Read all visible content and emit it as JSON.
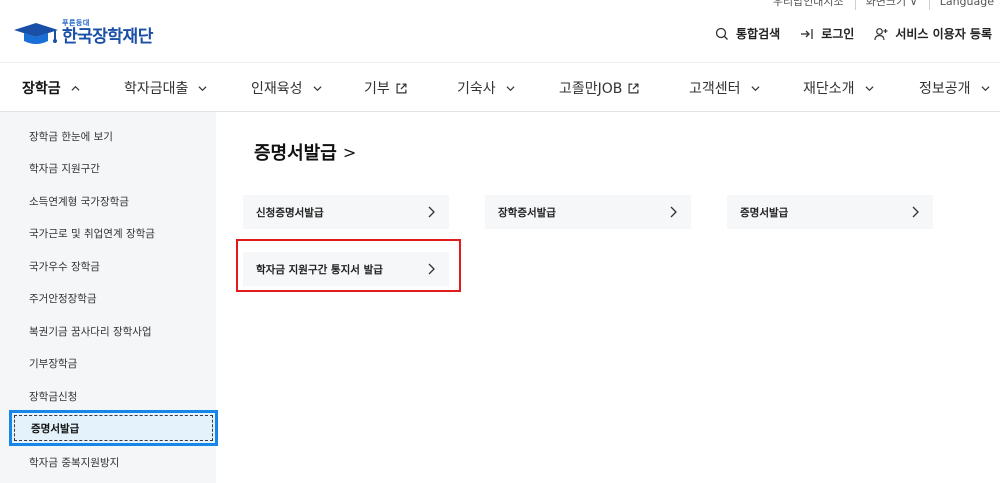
{
  "util_bar": {
    "items": [
      "우리밥인대지조",
      "화면크기 ∨",
      "Language"
    ]
  },
  "header": {
    "logo_small": "푸른등대",
    "logo_main": "한국장학재단",
    "actions": {
      "search": "통합검색",
      "login": "로그인",
      "register": "서비스 이용자 등록"
    }
  },
  "gnb": {
    "items": [
      {
        "label": "장학금",
        "chevron": "up"
      },
      {
        "label": "학자금대출",
        "chevron": "down"
      },
      {
        "label": "인재육성",
        "chevron": "down"
      },
      {
        "label": "기부",
        "icon": "external-link-icon"
      },
      {
        "label": "기숙사",
        "chevron": "down"
      },
      {
        "label": "고졸만JOB",
        "icon": "external-link-icon"
      },
      {
        "label": "고객센터",
        "chevron": "down"
      },
      {
        "label": "재단소개",
        "chevron": "down"
      },
      {
        "label": "정보공개",
        "chevron": "down"
      }
    ]
  },
  "sidebar": {
    "items": [
      "장학금 한눈에 보기",
      "학자금 지원구간",
      "소득연계형 국가장학금",
      "국가근로 및 취업연계 장학금",
      "국가우수 장학금",
      "주거안정장학금",
      "복권기금 꿈사다리 장학사업",
      "기부장학금",
      "장학금신청",
      "증명서발급",
      "학자금 중복지원방지"
    ],
    "active_index": 9
  },
  "main": {
    "title": "증명서발급",
    "title_suffix": ">",
    "cards": [
      "신청증명서발급",
      "장학증서발급",
      "증명서발급",
      "학자금 지원구간 통지서 발급"
    ],
    "highlighted_card_index": 3
  },
  "colors": {
    "brand": "#1a4fa8",
    "highlight_red": "#e01b1b",
    "active_blue": "#1687e8",
    "sidebar_bg": "#f5f6f8"
  }
}
